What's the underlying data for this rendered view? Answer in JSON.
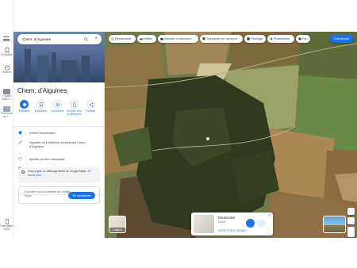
{
  "rail": {
    "menu_icon": "hamburger-menu-icon",
    "items": [
      {
        "label": "Enregistré",
        "icon": "bookmark-icon"
      },
      {
        "label": "Récents",
        "icon": "history-icon"
      },
      {
        "label": "L'Église Saint-J…",
        "icon": "church-thumbnail"
      },
      {
        "label": "Prefecture de S…",
        "icon": "building-thumbnail"
      }
    ],
    "download_label": "Télécharger l'appli"
  },
  "search": {
    "value": "Chem. d'Aiguines"
  },
  "place": {
    "title": "Chem. d'Aiguines",
    "actions": [
      {
        "label": "Itinéraires",
        "icon": "directions-icon"
      },
      {
        "label": "Enregistrer",
        "icon": "bookmark-icon"
      },
      {
        "label": "À proximité",
        "icon": "nearby-icon"
      },
      {
        "label": "Envoyer vers un téléphone",
        "icon": "phone-icon"
      },
      {
        "label": "Partager",
        "icon": "share-icon"
      }
    ],
    "info": [
      {
        "icon": "location-pin-icon",
        "text": "04500 Roumoules"
      },
      {
        "icon": "edit-pencil-icon",
        "text": "Signaler un problème concernant Chem. d'Aiguines"
      },
      {
        "icon": "add-place-icon",
        "text": "Ajouter un lieu manquant"
      },
      {
        "icon": "business-icon",
        "text": "Ajouter votre établissement"
      }
    ],
    "note_text": "Vous voyez un affichage limité de Google Maps.",
    "note_link": "En savoir plus",
    "signin_text": "Exploitez tout le potentiel de Google Maps",
    "signin_button": "Se connecter"
  },
  "map": {
    "chips": [
      {
        "label": "Restaurants",
        "icon": "restaurant-icon"
      },
      {
        "label": "Hôtels",
        "icon": "hotel-icon"
      },
      {
        "label": "Activités à découvrir",
        "icon": "camera-icon"
      },
      {
        "label": "Transports en commun",
        "icon": "transit-icon"
      },
      {
        "label": "Parkings",
        "icon": "parking-icon"
      },
      {
        "label": "Pharmacies",
        "icon": "pharmacy-icon"
      },
      {
        "label": "Dis…",
        "icon": "atm-icon"
      }
    ],
    "connect_button": "Connexion",
    "layers_label": "Calques",
    "card": {
      "title": "Roumoules",
      "subtitle": "Calcat",
      "link": "DERECTION & SUIVANT"
    },
    "streetview_label": ""
  },
  "colors": {
    "accent": "#1a73e8",
    "forest": "#2f3a1e",
    "field_brown": "#8a6a3f"
  }
}
